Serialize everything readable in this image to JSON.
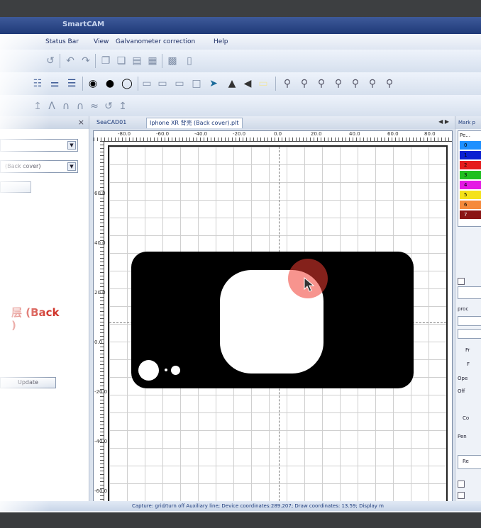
{
  "app": {
    "title_fragment": "SmartCAM"
  },
  "menu": {
    "items": [
      {
        "label": "Status Bar"
      },
      {
        "label": "View"
      },
      {
        "label": "Galvanometer correction"
      },
      {
        "label": "Help"
      }
    ]
  },
  "left_panel": {
    "combo1_value": "",
    "combo2_value": "(Back cover)",
    "red_label_line1": "层 (Back",
    "red_label_line2": ")",
    "update_button": "Update"
  },
  "tabs": [
    {
      "label": "SeaCAD01"
    },
    {
      "label": "Iphone XR 背壳 (Back cover).plt"
    }
  ],
  "ruler": {
    "h_labels": [
      "-80.0",
      "-60.0",
      "-40.0",
      "-20.0",
      "0.0",
      "20.0",
      "40.0",
      "60.0",
      "80.0"
    ],
    "v_labels": [
      "60.0",
      "40.0",
      "20.0",
      "0.0",
      "-20.0",
      "-40.0",
      "-60.0"
    ]
  },
  "right_panel": {
    "header": "Mark p",
    "list_header": "Pe...",
    "layers": [
      {
        "label": "0",
        "color": "#1e90ff"
      },
      {
        "label": "1",
        "color": "#0a1fd1"
      },
      {
        "label": "2",
        "color": "#e51c1c"
      },
      {
        "label": "3",
        "color": "#1fbf1f"
      },
      {
        "label": "4",
        "color": "#e41ae4"
      },
      {
        "label": "5",
        "color": "#f4e21b"
      },
      {
        "label": "6",
        "color": "#f58a3c"
      },
      {
        "label": "7",
        "color": "#8a1414"
      }
    ],
    "items": [
      "proc",
      "Fr",
      "F",
      "Ope",
      "Off",
      "Co",
      "Pen",
      "Re"
    ]
  },
  "status": {
    "text": "Capture: grid/turn off Auxiliary line; Device coordinates:289.207; Draw coordinates: 13.59; Display m"
  }
}
